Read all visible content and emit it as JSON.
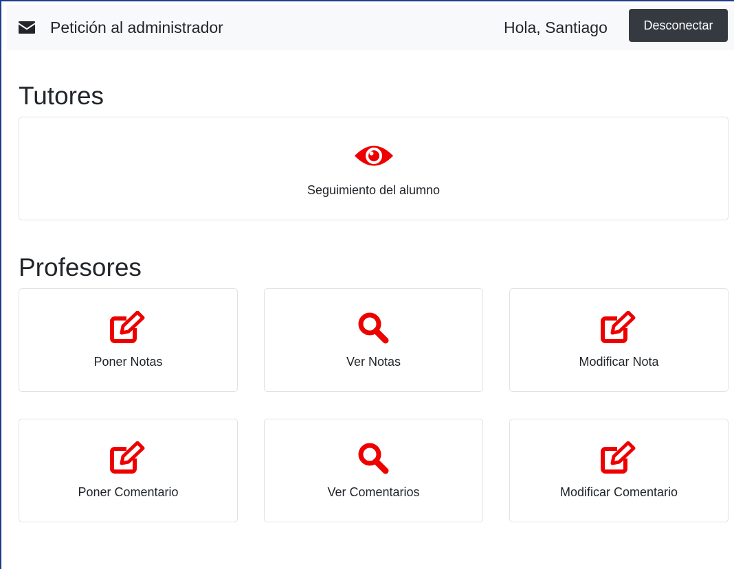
{
  "navbar": {
    "petition_icon": "envelope-icon",
    "petition_label": "Petición al administrador",
    "greeting": "Hola, Santiago",
    "logout_label": "Desconectar"
  },
  "accent_color": "#ee0000",
  "tutores": {
    "title": "Tutores",
    "cards": [
      {
        "label": "Seguimiento del alumno",
        "icon": "eye-icon"
      }
    ]
  },
  "profesores": {
    "title": "Profesores",
    "cards": [
      {
        "label": "Poner Notas",
        "icon": "edit-icon"
      },
      {
        "label": "Ver Notas",
        "icon": "search-icon"
      },
      {
        "label": "Modificar Nota",
        "icon": "edit-icon"
      },
      {
        "label": "Poner Comentario",
        "icon": "edit-icon"
      },
      {
        "label": "Ver Comentarios",
        "icon": "search-icon"
      },
      {
        "label": "Modificar Comentario",
        "icon": "edit-icon"
      }
    ]
  }
}
